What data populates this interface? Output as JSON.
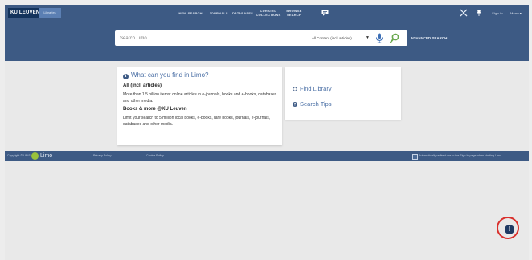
{
  "header": {
    "logo": "KU LEUVEN",
    "libraries_badge": "Libraries",
    "nav": [
      {
        "label": "NEW SEARCH"
      },
      {
        "label": "JOURNALS"
      },
      {
        "label": "DATABASES"
      },
      {
        "label": "CURATED COLLECTIONS"
      },
      {
        "label": "BROWSE SEARCH"
      }
    ],
    "sign_in": "Sign in",
    "menu": "Menu",
    "menu_caret": "▾"
  },
  "search": {
    "placeholder": "Search Limo",
    "scope": "All Content (incl. articles)",
    "scope_caret": "▼",
    "advanced": "ADVANCED SEARCH"
  },
  "info_card": {
    "title": "What can you find in Limo?",
    "sections": [
      {
        "heading": "All (incl. articles)",
        "text": "More than 1,5 billion items: online articles in e-journals, books and e-books, databases and other media."
      },
      {
        "heading": "Books & more @KU Leuven",
        "text": "Limit your search to 5 million local books, e-books, rare books, journals, e-journals, databases and other media."
      }
    ]
  },
  "links_card": {
    "items": [
      {
        "label": "Find Library",
        "icon": "location-pin-icon"
      },
      {
        "label": "Search Tips",
        "icon": "help-circle-icon"
      }
    ]
  },
  "footer": {
    "copyright": "Copyright © LIBIS",
    "brand": "Limo",
    "privacy": "Privacy Policy",
    "cookie": "Cookie Policy",
    "redirect": "Automatically redirect me to the Sign In page when starting Limo"
  },
  "feedback": {
    "glyph": "!"
  },
  "colors": {
    "header": "#3d5a84",
    "accent": "#4a6fa5",
    "feedback_ring": "#d9302c",
    "limo_green": "#9ac23c"
  }
}
